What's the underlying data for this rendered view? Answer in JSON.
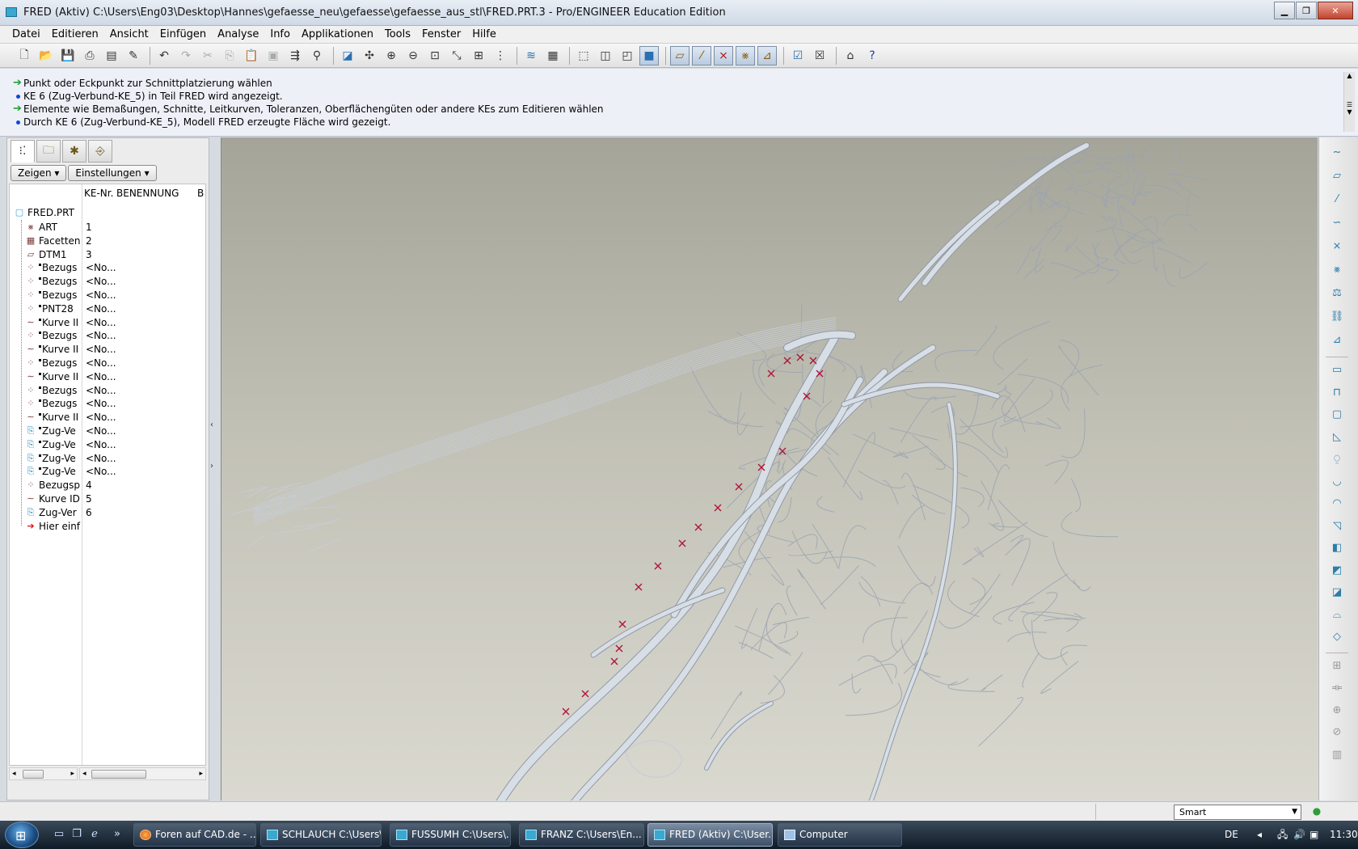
{
  "window": {
    "title": "FRED (Aktiv) C:\\Users\\Eng03\\Desktop\\Hannes\\gefaesse_neu\\gefaesse\\gefaesse_aus_stl\\FRED.PRT.3 - Pro/ENGINEER Education Edition",
    "buttons": [
      "minimize",
      "maximize",
      "close"
    ]
  },
  "menubar": {
    "items": [
      "Datei",
      "Editieren",
      "Ansicht",
      "Einfügen",
      "Analyse",
      "Info",
      "Applikationen",
      "Tools",
      "Fenster",
      "Hilfe"
    ]
  },
  "toolbar": {
    "icons": [
      "new-icon",
      "open-icon",
      "save-icon",
      "print-icon",
      "print-preview-icon",
      "edit-icon",
      "undo-icon",
      "redo-icon",
      "cut-icon",
      "copy-icon",
      "paste-icon",
      "paste-special-icon",
      "regenerate-icon",
      "find-icon",
      "repaint-icon",
      "spin-center-icon",
      "zoom-in-icon",
      "zoom-out-icon",
      "refit-icon",
      "orient-icon",
      "view-manager-icon",
      "saved-views-icon",
      "layers-icon",
      "appearance-icon",
      "wireframe-icon",
      "hidden-line-icon",
      "no-hidden-icon",
      "shading-icon",
      "datum-planes-icon",
      "datum-axes-icon",
      "datum-points-icon",
      "coordinate-systems-icon",
      "annotation-display-icon",
      "activate-window-icon",
      "close-window-icon",
      "home-icon",
      "context-help-icon"
    ]
  },
  "messages": [
    {
      "type": "prompt",
      "text": "Punkt oder Eckpunkt zur Schnittplatzierung wählen"
    },
    {
      "type": "info",
      "text": "KE 6 (Zug-Verbund-KE_5) in Teil FRED wird angezeigt."
    },
    {
      "type": "prompt",
      "text": "Elemente wie Bemaßungen, Schnitte, Leitkurven, Toleranzen, Oberflächengüten oder andere KEs zum Editieren wählen"
    },
    {
      "type": "info",
      "text": "Durch KE 6 (Zug-Verbund-KE_5), Modell FRED erzeugte Fläche wird gezeigt."
    }
  ],
  "navigator": {
    "tabs": [
      "model-tree-icon",
      "folder-browser-icon",
      "favorites-icon",
      "connections-icon"
    ],
    "buttons": {
      "show": "Zeigen",
      "settings": "Einstellungen"
    },
    "columns": {
      "num": "KE-Nr.",
      "name": "BENENNUNG",
      "extra": "B"
    },
    "root": "FRED.PRT",
    "rows": [
      {
        "label": "ART",
        "num": "1",
        "icon": "hatch-icon",
        "pinned": false
      },
      {
        "label": "Facetten",
        "num": "2",
        "icon": "facet-icon",
        "pinned": false
      },
      {
        "label": "DTM1",
        "num": "3",
        "icon": "datum-plane-icon",
        "pinned": false
      },
      {
        "label": "Bezugs",
        "num": "<No...",
        "icon": "datum-point-icon",
        "pinned": true
      },
      {
        "label": "Bezugs",
        "num": "<No...",
        "icon": "datum-point-icon",
        "pinned": true
      },
      {
        "label": "Bezugs",
        "num": "<No...",
        "icon": "datum-point-icon",
        "pinned": true
      },
      {
        "label": "PNT28",
        "num": "<No...",
        "icon": "datum-point-icon",
        "pinned": true
      },
      {
        "label": "Kurve II",
        "num": "<No...",
        "icon": "curve-icon",
        "pinned": true
      },
      {
        "label": "Bezugs",
        "num": "<No...",
        "icon": "datum-point-icon",
        "pinned": true
      },
      {
        "label": "Kurve II",
        "num": "<No...",
        "icon": "curve-icon",
        "pinned": true
      },
      {
        "label": "Bezugs",
        "num": "<No...",
        "icon": "datum-point-icon",
        "pinned": true
      },
      {
        "label": "Kurve II",
        "num": "<No...",
        "icon": "curve-icon",
        "pinned": true
      },
      {
        "label": "Bezugs",
        "num": "<No...",
        "icon": "datum-point-icon",
        "pinned": true
      },
      {
        "label": "Bezugs",
        "num": "<No...",
        "icon": "datum-point-icon",
        "pinned": true
      },
      {
        "label": "Kurve II",
        "num": "<No...",
        "icon": "curve-icon",
        "pinned": true
      },
      {
        "label": "Zug-Ve",
        "num": "<No...",
        "icon": "swept-blend-icon",
        "pinned": true
      },
      {
        "label": "Zug-Ve",
        "num": "<No...",
        "icon": "swept-blend-icon",
        "pinned": true
      },
      {
        "label": "Zug-Ve",
        "num": "<No...",
        "icon": "swept-blend-icon",
        "pinned": true
      },
      {
        "label": "Zug-Ve",
        "num": "<No...",
        "icon": "swept-blend-icon",
        "pinned": true
      },
      {
        "label": "Bezugsp",
        "num": "4",
        "icon": "datum-point-icon",
        "pinned": false
      },
      {
        "label": "Kurve ID",
        "num": "5",
        "icon": "curve-icon",
        "pinned": false
      },
      {
        "label": "Zug-Ver",
        "num": "6",
        "icon": "swept-blend-icon",
        "pinned": false
      },
      {
        "label": "Hier einf",
        "num": "",
        "icon": "insert-here-icon",
        "pinned": false
      }
    ]
  },
  "right_toolbar": {
    "icons": [
      "sketch-icon",
      "datum-plane-tool-icon",
      "datum-axis-tool-icon",
      "datum-curve-tool-icon",
      "datum-point-tool-icon",
      "coordinate-system-tool-icon",
      "analysis-tool-icon",
      "chain-tool-icon",
      "annotation-tool-icon",
      "surface-copy-icon",
      "extrude-icon",
      "revolve-icon",
      "variable-sweep-icon",
      "blend-icon",
      "hole-icon",
      "round-icon",
      "chamfer-icon",
      "shell-icon",
      "rib-icon",
      "draft-icon",
      "boundary-blend-icon",
      "style-icon",
      "pattern-icon",
      "mirror-icon",
      "merge-icon",
      "trim-icon",
      "thicken-icon"
    ]
  },
  "statusbar": {
    "filter": "Smart"
  },
  "taskbar": {
    "tasks": [
      {
        "label": "Foren auf CAD.de - ...",
        "icon": "firefox-icon",
        "active": false
      },
      {
        "label": "SCHLAUCH C:\\Users\\...",
        "icon": "proe-icon",
        "active": false
      },
      {
        "label": "FUSSUMH C:\\Users\\...",
        "icon": "proe-icon",
        "active": false
      },
      {
        "label": "FRANZ C:\\Users\\En...",
        "icon": "proe-icon",
        "active": false
      },
      {
        "label": "FRED (Aktiv) C:\\User...",
        "icon": "proe-icon",
        "active": true
      },
      {
        "label": "Computer",
        "icon": "computer-icon",
        "active": false
      }
    ],
    "tray": {
      "language": "DE",
      "time": "11:30"
    }
  }
}
